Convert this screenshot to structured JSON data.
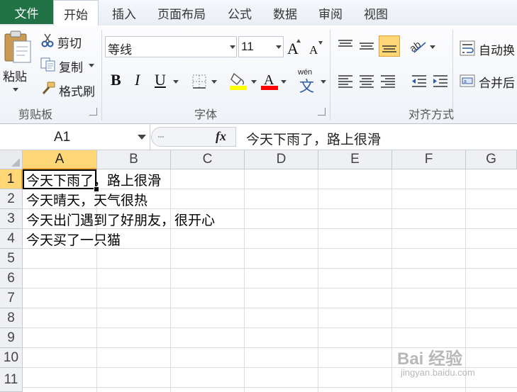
{
  "tabs": {
    "file": "文件",
    "items": [
      "开始",
      "插入",
      "页面布局",
      "公式",
      "数据",
      "审阅",
      "视图"
    ]
  },
  "clipboard": {
    "paste": "粘贴",
    "cut": "剪切",
    "copy": "复制",
    "format_painter": "格式刷",
    "group_label": "剪贴板"
  },
  "font": {
    "name": "等线",
    "size": "11",
    "bold": "B",
    "italic": "I",
    "underline": "U",
    "group_label": "字体",
    "wen_glyph": "wén",
    "wen_char": "文"
  },
  "alignment": {
    "wrap_text": "自动换",
    "merge": "合并后",
    "group_label": "对齐方式"
  },
  "formula_bar": {
    "cell_ref": "A1",
    "fx": "fx",
    "content": "今天下雨了，路上很滑"
  },
  "columns": [
    "A",
    "B",
    "C",
    "D",
    "E",
    "F",
    "G"
  ],
  "rows": [
    "1",
    "2",
    "3",
    "4",
    "5",
    "6",
    "7",
    "8",
    "9",
    "10",
    "11"
  ],
  "cells": [
    "今天下雨了，路上很滑",
    "今天晴天，天气很热",
    "今天出门遇到了好朋友，很开心",
    "今天买了一只猫"
  ],
  "colors": {
    "file_tab": "#217346",
    "selected_header": "#ffd776",
    "highlight_yellow": "#ffff00",
    "font_red": "#ff0000"
  },
  "watermark": {
    "brand": "Bai 经验",
    "url": "jingyan.baidu.com"
  }
}
